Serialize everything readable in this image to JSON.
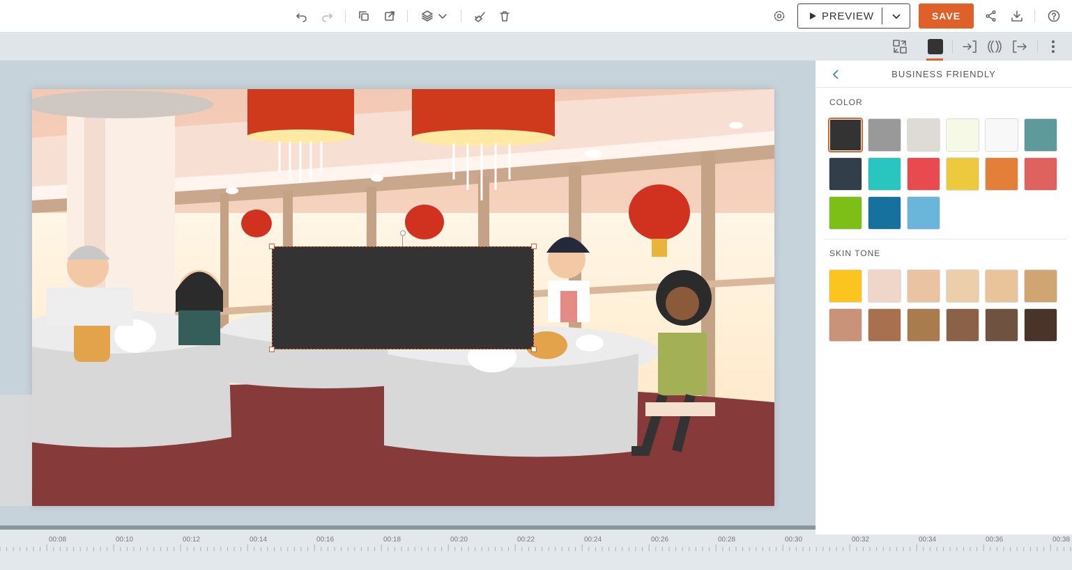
{
  "toolbar": {
    "preview_label": "PREVIEW",
    "save_label": "SAVE"
  },
  "panel": {
    "title": "BUSINESS FRIENDLY",
    "color_label": "COLOR",
    "skin_label": "SKIN TONE",
    "colors": [
      "#333333",
      "#999999",
      "#dedbd6",
      "#f6f9e6",
      "#f8f8f8",
      "#5f9a9a",
      "#323f4b",
      "#29c6c0",
      "#e84a4f",
      "#ecc93d",
      "#e47f3a",
      "#e0625e",
      "#7dbf17",
      "#17719f",
      "#6ab6da"
    ],
    "skin_tones": [
      "#fcc41e",
      "#efd6c8",
      "#eac3a3",
      "#eccfaa",
      "#e9c39a",
      "#d1a572",
      "#c9937a",
      "#a8704f",
      "#a97c4d",
      "#8b6147",
      "#6f5240",
      "#4a342a"
    ],
    "selected_color": "#333333"
  },
  "timeline": {
    "labels": [
      "00:08",
      "00:10",
      "00:12",
      "00:14",
      "00:16",
      "00:18",
      "00:20",
      "00:22",
      "00:24",
      "00:26",
      "00:28",
      "00:30",
      "00:32",
      "00:34",
      "00:36",
      "00:38"
    ]
  },
  "colors": {
    "accent": "#e0602a",
    "selection_fill": "#333333"
  }
}
